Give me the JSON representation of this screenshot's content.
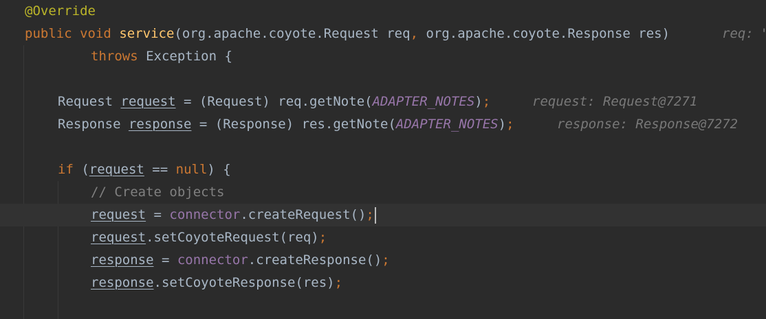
{
  "editor": {
    "lines": [
      {
        "tokens": [
          {
            "t": "@Override",
            "c": "ann"
          }
        ]
      },
      {
        "tokens": [
          {
            "t": "public",
            "c": "kw"
          },
          {
            "t": " "
          },
          {
            "t": "void",
            "c": "kw"
          },
          {
            "t": " "
          },
          {
            "t": "service",
            "c": "fn"
          },
          {
            "t": "(org.apache.coyote.Request req"
          },
          {
            "t": ",",
            "c": "kw"
          },
          {
            "t": " org.apache.coyote.Response res)"
          }
        ],
        "hint": "req: \""
      },
      {
        "tokens": [
          {
            "t": "throws",
            "c": "kw"
          },
          {
            "t": " Exception {"
          }
        ]
      },
      {
        "tokens": []
      },
      {
        "tokens": [
          {
            "t": "Request "
          },
          {
            "t": "request",
            "c": "var"
          },
          {
            "t": " = (Request) req.getNote("
          },
          {
            "t": "ADAPTER_NOTES",
            "c": "const"
          },
          {
            "t": ")"
          },
          {
            "t": ";",
            "c": "kw"
          }
        ],
        "hint": "request: Request@7271"
      },
      {
        "tokens": [
          {
            "t": "Response "
          },
          {
            "t": "response",
            "c": "var"
          },
          {
            "t": " = (Response) res.getNote("
          },
          {
            "t": "ADAPTER_NOTES",
            "c": "const"
          },
          {
            "t": ")"
          },
          {
            "t": ";",
            "c": "kw"
          }
        ],
        "hint": "response: Response@7272"
      },
      {
        "tokens": []
      },
      {
        "tokens": [
          {
            "t": "if",
            "c": "kw"
          },
          {
            "t": " ("
          },
          {
            "t": "request",
            "c": "var"
          },
          {
            "t": " == "
          },
          {
            "t": "null",
            "c": "kw"
          },
          {
            "t": ") {"
          }
        ]
      },
      {
        "tokens": [
          {
            "t": "// Create objects",
            "c": "cmt"
          }
        ]
      },
      {
        "tokens": [
          {
            "t": "request",
            "c": "var"
          },
          {
            "t": " = "
          },
          {
            "t": "connector",
            "c": "field"
          },
          {
            "t": ".createRequest()"
          },
          {
            "t": ";",
            "c": "kw"
          }
        ],
        "current": true
      },
      {
        "tokens": [
          {
            "t": "request",
            "c": "var"
          },
          {
            "t": ".setCoyoteRequest(req)"
          },
          {
            "t": ";",
            "c": "kw"
          }
        ]
      },
      {
        "tokens": [
          {
            "t": "response",
            "c": "var"
          },
          {
            "t": " = "
          },
          {
            "t": "connector",
            "c": "field"
          },
          {
            "t": ".createResponse()"
          },
          {
            "t": ";",
            "c": "kw"
          }
        ]
      },
      {
        "tokens": [
          {
            "t": "response",
            "c": "var"
          },
          {
            "t": ".setCoyoteResponse(res)"
          },
          {
            "t": ";",
            "c": "kw"
          }
        ]
      },
      {
        "tokens": []
      }
    ]
  }
}
